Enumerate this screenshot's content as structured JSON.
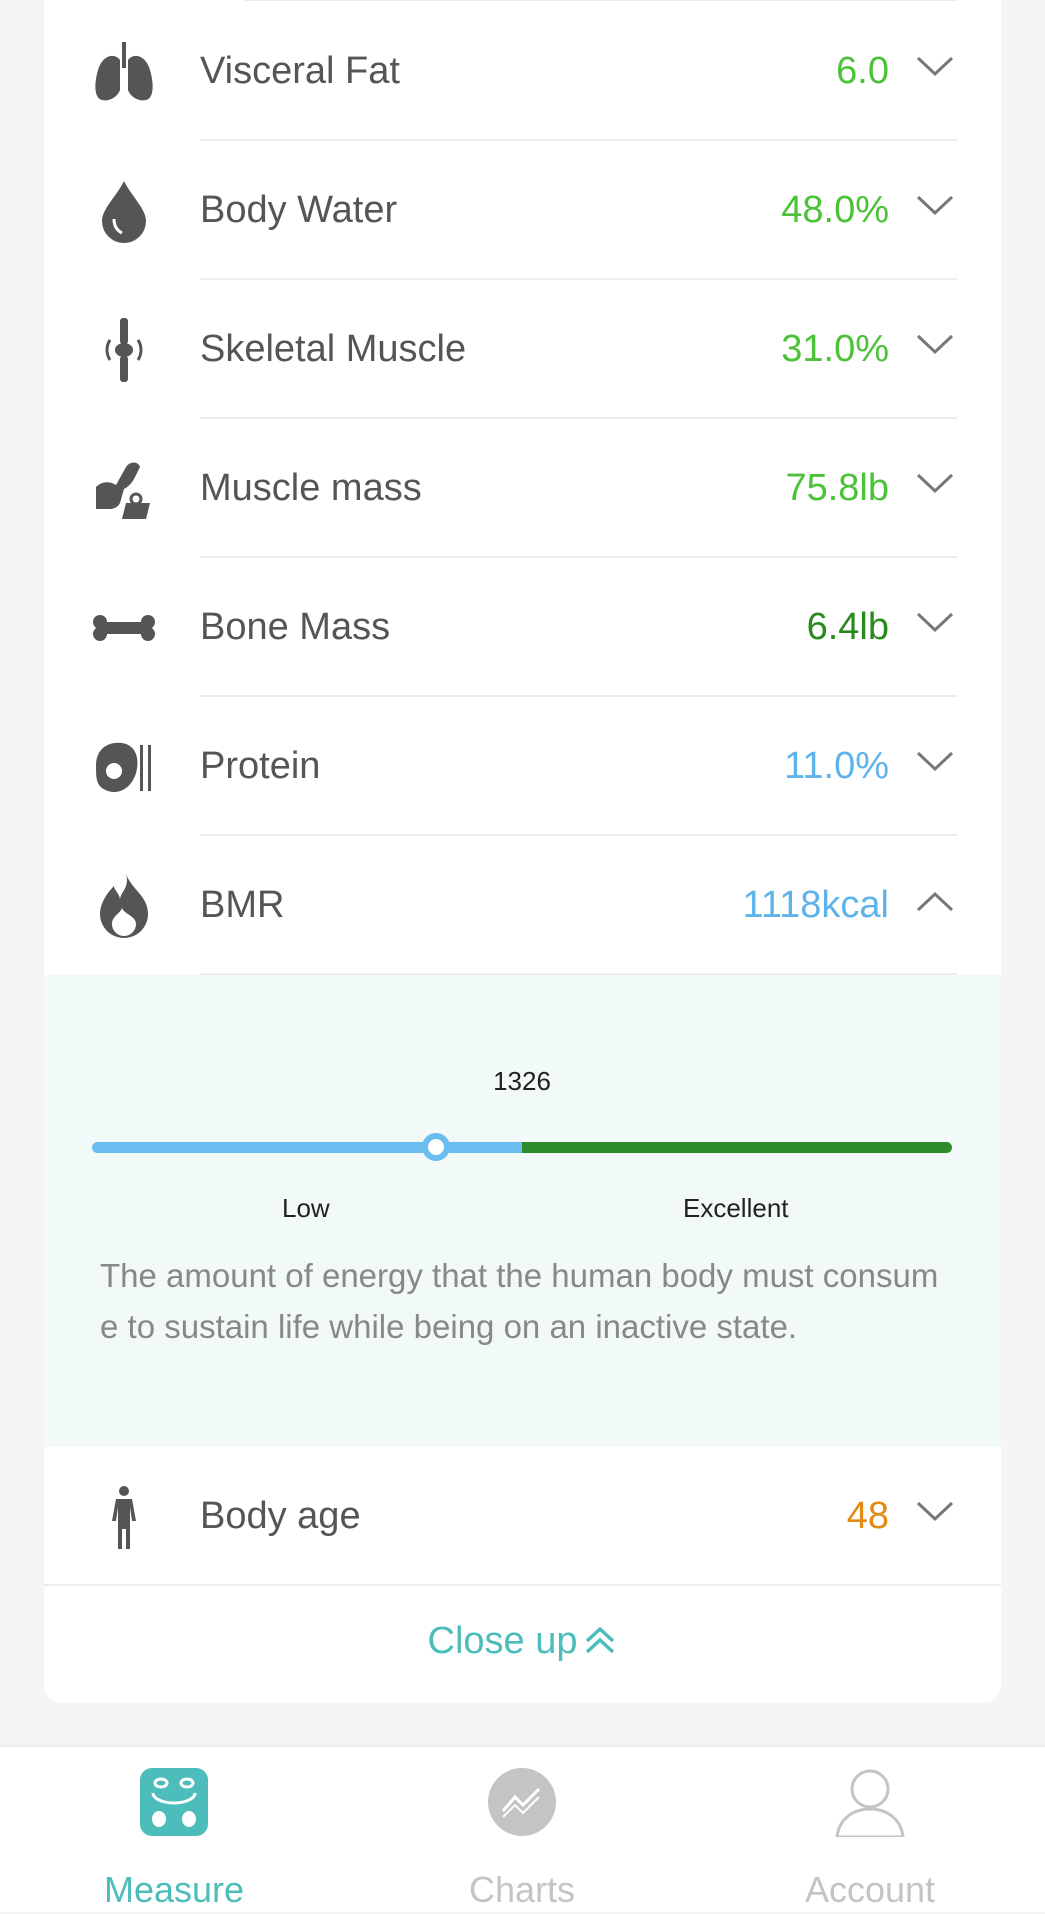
{
  "metrics": [
    {
      "label": "Visceral Fat",
      "value": "6.0",
      "color": "#4cc238",
      "icon": "lungs-icon",
      "expanded": false
    },
    {
      "label": "Body Water",
      "value": "48.0%",
      "color": "#4cc238",
      "icon": "water-drop-icon",
      "expanded": false
    },
    {
      "label": "Skeletal Muscle",
      "value": "31.0%",
      "color": "#4cc238",
      "icon": "joint-bone-icon",
      "expanded": false
    },
    {
      "label": "Muscle mass",
      "value": "75.8lb",
      "color": "#4cc238",
      "icon": "flexed-arm-icon",
      "expanded": false
    },
    {
      "label": "Bone Mass",
      "value": "6.4lb",
      "color": "#2b8a1e",
      "icon": "bone-icon",
      "expanded": false
    },
    {
      "label": "Protein",
      "value": "11.0%",
      "color": "#5eb4ea",
      "icon": "protein-icon",
      "expanded": false
    },
    {
      "label": "BMR",
      "value": "1118kcal",
      "color": "#5eb4ea",
      "icon": "flame-icon",
      "expanded": true
    },
    {
      "label": "Body age",
      "value": "48",
      "color": "#e28a12",
      "icon": "person-icon",
      "expanded": false
    }
  ],
  "bmr_detail": {
    "reference_value": "1326",
    "range_labels": [
      "Low",
      "Excellent"
    ],
    "description": "The amount of energy that the human body must consume to sustain life while being on an inactive state.",
    "colors": {
      "low": "#6bbdf0",
      "excellent": "#2e8b2a"
    },
    "marker_fraction": 0.4
  },
  "close_up": {
    "label": "Close up"
  },
  "tabbar": {
    "tabs": [
      {
        "label": "Measure",
        "icon": "scale-icon",
        "active": true,
        "color": "#4dbdbb"
      },
      {
        "label": "Charts",
        "icon": "chart-icon",
        "active": false,
        "color": "#c4c4c4"
      },
      {
        "label": "Account",
        "icon": "user-icon",
        "active": false,
        "color": "#c4c4c4"
      }
    ]
  }
}
